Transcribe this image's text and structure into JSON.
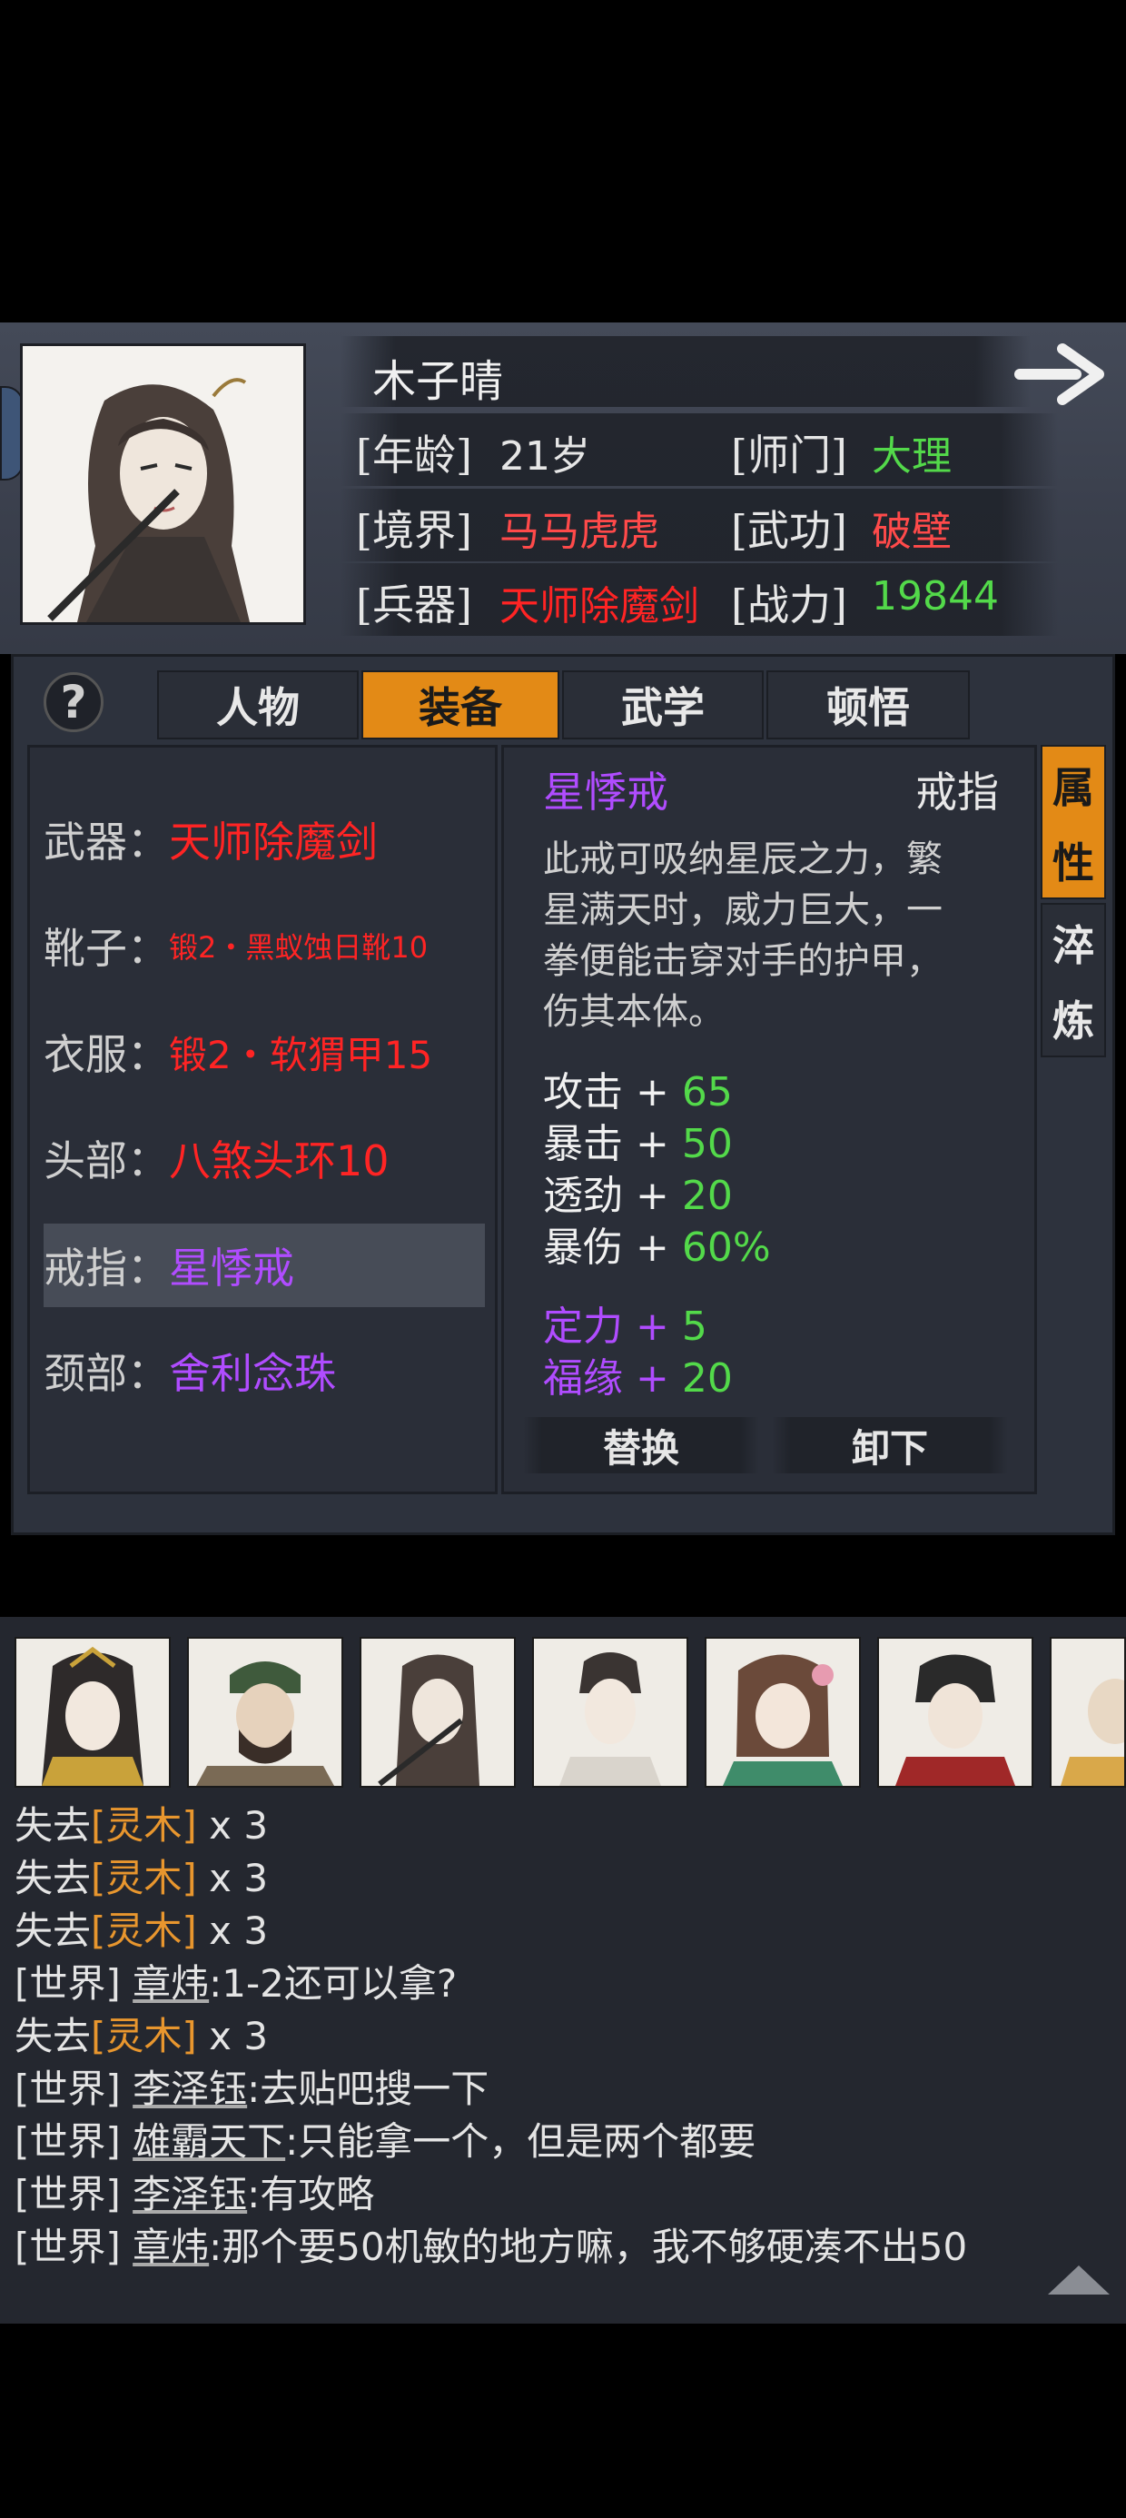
{
  "character": {
    "name": "木子晴",
    "fields": [
      {
        "label": "[年龄]",
        "value": "21岁",
        "color": "#e6e6e6"
      },
      {
        "label": "[师门]",
        "value": "大理",
        "color": "#53d94a"
      },
      {
        "label": "[境界]",
        "value": "马马虎虎",
        "color": "#ff4a4a"
      },
      {
        "label": "[武功]",
        "value": "破壁",
        "color": "#ff4a4a"
      },
      {
        "label": "[兵器]",
        "value": "天师除魔剑",
        "color": "#ff2424"
      },
      {
        "label": "[战力]",
        "value": "19844",
        "color": "#53d94a"
      }
    ]
  },
  "tabs": {
    "help": "?",
    "items": [
      "人物",
      "装备",
      "武学",
      "顿悟"
    ],
    "active_index": 1
  },
  "slots": [
    {
      "key": "武器：",
      "value": "天师除魔剑",
      "color": "red"
    },
    {
      "key": "靴子：",
      "value": "锻2・黑蚁蚀日靴10",
      "color": "red"
    },
    {
      "key": "衣服：",
      "value": "锻2・软猬甲15",
      "color": "red"
    },
    {
      "key": "头部：",
      "value": "八煞头环10",
      "color": "red"
    },
    {
      "key": "戒指：",
      "value": "星悸戒",
      "color": "purple"
    },
    {
      "key": "颈部：",
      "value": "舍利念珠",
      "color": "purple"
    }
  ],
  "selected_slot_index": 4,
  "detail": {
    "name": "星悸戒",
    "type": "戒指",
    "description": "此戒可吸纳星辰之力，繁星满天时，威力巨大，一拳便能击穿对手的护甲，伤其本体。",
    "description_lines": [
      "此戒可吸纳星辰之力，繁",
      "星满天时，威力巨大，一",
      "拳便能击穿对手的护甲，",
      "伤其本体。"
    ],
    "stats": [
      {
        "name": "攻击",
        "plus": "+",
        "value": "65"
      },
      {
        "name": "暴击",
        "plus": "+",
        "value": "50"
      },
      {
        "name": "透劲",
        "plus": "+",
        "value": "20"
      },
      {
        "name": "暴伤",
        "plus": "+",
        "value": "60%"
      }
    ],
    "special_stats": [
      {
        "name": "定力",
        "plus": "+",
        "value": "5"
      },
      {
        "name": "福缘",
        "plus": "+",
        "value": "20"
      }
    ],
    "replace_label": "替换",
    "unequip_label": "卸下"
  },
  "side_tabs": [
    {
      "chars": [
        "属",
        "性"
      ],
      "active": true
    },
    {
      "chars": [
        "淬",
        "炼"
      ],
      "active": false
    }
  ],
  "roster_count": 7,
  "chat": [
    {
      "prefix": "失去",
      "item": "[灵木]",
      "suffix": " x 3"
    },
    {
      "prefix": "失去",
      "item": "[灵木]",
      "suffix": " x 3"
    },
    {
      "prefix": "失去",
      "item": "[灵木]",
      "suffix": " x 3"
    },
    {
      "channel": "[世界]",
      "user": "章炜",
      "text": ":1-2还可以拿?"
    },
    {
      "prefix": "失去",
      "item": "[灵木]",
      "suffix": " x 3"
    },
    {
      "channel": "[世界]",
      "user": "李泽钰",
      "text": ":去贴吧搜一下"
    },
    {
      "channel": "[世界]",
      "user": "雄霸天下",
      "text": ":只能拿一个，但是两个都要"
    },
    {
      "channel": "[世界]",
      "user": "李泽钰",
      "text": ":有攻略"
    },
    {
      "channel": "[世界]",
      "user": "章炜",
      "text": ":那个要50机敏的地方嘛，我不够硬凑不出50"
    }
  ]
}
